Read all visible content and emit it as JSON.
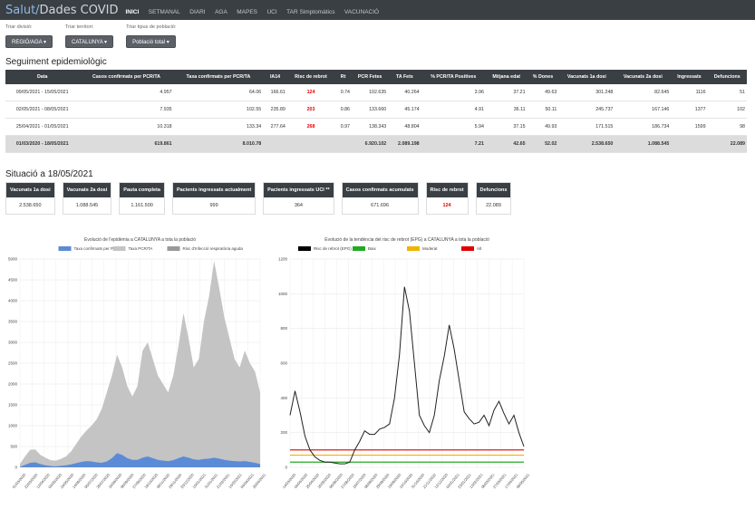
{
  "brand": {
    "part1": "Salut/",
    "part2": "Dades COVID"
  },
  "nav": [
    "INICI",
    "SETMANAL",
    "DIARI",
    "AGA",
    "MAPES",
    "UCI",
    "TAR Simptomàtics",
    "VACUNACIÓ"
  ],
  "filters": [
    {
      "label": "Triar divisió:",
      "value": "REGIÓ/AGA"
    },
    {
      "label": "Triar territori:",
      "value": "CATALUNYA"
    },
    {
      "label": "Triar tipus de població:",
      "value": "Població total"
    }
  ],
  "section1_title": "Seguiment epidemiològic",
  "table": {
    "headers": [
      "Data",
      "Casos confirmats per PCR/TA",
      "Taxa confirmats per PCR/TA",
      "IA14",
      "Risc de rebrot",
      "Rt",
      "PCR Fetes",
      "TA Fets",
      "% PCR/TA Positives",
      "Mitjana edat",
      "% Dones",
      "Vacunats 1a dosi",
      "Vacunats 2a dosi",
      "Ingressats",
      "Defuncions"
    ],
    "rows": [
      [
        "09/05/2021 - 15/05/2021",
        "4.957",
        "64.06",
        "166.61",
        "124",
        "0.74",
        "102.635",
        "40.264",
        "3.96",
        "37.21",
        "49.63",
        "301.248",
        "82.645",
        "1116",
        "51"
      ],
      [
        "02/05/2021 - 08/05/2021",
        "7.935",
        "102.55",
        "235.89",
        "203",
        "0.86",
        "133.660",
        "45.174",
        "4.91",
        "36.11",
        "50.11",
        "245.737",
        "167.146",
        "1377",
        "102"
      ],
      [
        "25/04/2021 - 01/05/2021",
        "10.318",
        "133.34",
        "277.64",
        "268",
        "0.97",
        "138.343",
        "48.804",
        "5.94",
        "37.15",
        "49.93",
        "171.515",
        "186.734",
        "1599",
        "98"
      ]
    ],
    "total": [
      "01/03/2020 - 18/05/2021",
      "619.861",
      "8.010.78",
      "",
      "",
      "",
      "6.920.102",
      "2.089.198",
      "7.21",
      "42.65",
      "52.02",
      "2.538.650",
      "1.088.545",
      "",
      "22.089"
    ]
  },
  "section2_title": "Situació a 18/05/2021",
  "cards": [
    {
      "label": "Vacunats 1a dosi",
      "value": "2.538.650",
      "red": false
    },
    {
      "label": "Vacunats 2a dosi",
      "value": "1.088.545",
      "red": false
    },
    {
      "label": "Pauta completa",
      "value": "1.161.500",
      "red": false
    },
    {
      "label": "Pacients ingressats actualment",
      "value": "999",
      "red": false
    },
    {
      "label": "Pacients ingressats UCI **",
      "value": "364",
      "red": false
    },
    {
      "label": "Casos confirmats acumulats",
      "value": "671.696",
      "red": false
    },
    {
      "label": "Risc de rebrot",
      "value": "124",
      "red": true
    },
    {
      "label": "Defuncions",
      "value": "22.089",
      "red": false
    }
  ],
  "chart_data": [
    {
      "type": "area",
      "title": "Evolució de l'epidèmia a CATALUNYA a tota la població",
      "legend": [
        "Taxa confirmats per PCR/TA",
        "Taxa PCR/TA",
        "Risc d'Infecció respiratòria aguda"
      ],
      "colors": [
        "#5b8bd6",
        "#c4c4c4",
        "#999999"
      ],
      "ylim": [
        0,
        5000
      ],
      "yticks": [
        0,
        500,
        1000,
        1500,
        2000,
        2500,
        3000,
        3500,
        4000,
        4500,
        5000
      ],
      "series": [
        {
          "name": "Taxa PCR/TA",
          "values": [
            80,
            260,
            420,
            430,
            300,
            230,
            170,
            160,
            200,
            260,
            380,
            560,
            740,
            880,
            1000,
            1150,
            1400,
            1800,
            2200,
            2700,
            2400,
            1950,
            1700,
            1950,
            2800,
            3000,
            2600,
            2200,
            2000,
            1800,
            2200,
            2900,
            3700,
            3100,
            2400,
            2600,
            3500,
            4100,
            4950,
            4300,
            3600,
            3100,
            2600,
            2400,
            2800,
            2500,
            2300,
            1800
          ]
        },
        {
          "name": "Taxa confirmats per PCR/TA",
          "values": [
            10,
            60,
            110,
            120,
            80,
            50,
            30,
            25,
            35,
            50,
            70,
            100,
            130,
            150,
            140,
            120,
            110,
            140,
            220,
            340,
            300,
            220,
            180,
            180,
            230,
            260,
            220,
            180,
            160,
            150,
            170,
            220,
            260,
            230,
            190,
            180,
            200,
            210,
            230,
            210,
            180,
            160,
            150,
            140,
            150,
            130,
            110,
            80
          ]
        }
      ],
      "xlabels": [
        "01/03/2020",
        "22/03/2020",
        "12/04/2020",
        "03/05/2020",
        "24/05/2020",
        "14/06/2020",
        "05/07/2020",
        "26/07/2020",
        "16/08/2020",
        "06/09/2020",
        "27/09/2020",
        "18/10/2020",
        "08/11/2020",
        "29/11/2020",
        "20/12/2020",
        "10/01/2021",
        "31/01/2021",
        "21/02/2021",
        "14/03/2021",
        "04/04/2021",
        "25/04/2021"
      ]
    },
    {
      "type": "line",
      "title": "Evolució de la tendència del risc de rebrot (EPG) a CATALUNYA a tota la població",
      "legend": [
        "Risc de rebrot (EPG)",
        "Baix",
        "Moderat",
        "Alt"
      ],
      "colors": [
        "#000000",
        "#22aa22",
        "#f2b200",
        "#e00000"
      ],
      "ylim": [
        0,
        1200
      ],
      "yticks": [
        0,
        200,
        400,
        600,
        800,
        1000,
        1200
      ],
      "series": [
        {
          "name": "Risc de rebrot (EPG)",
          "values": [
            300,
            440,
            320,
            180,
            100,
            60,
            40,
            30,
            30,
            25,
            20,
            20,
            30,
            100,
            150,
            210,
            190,
            190,
            220,
            230,
            250,
            400,
            650,
            1040,
            900,
            600,
            300,
            240,
            200,
            300,
            500,
            640,
            820,
            680,
            500,
            320,
            280,
            250,
            260,
            300,
            240,
            330,
            380,
            310,
            250,
            300,
            200,
            120
          ]
        },
        {
          "name": "Baix",
          "values": [
            30,
            30
          ]
        },
        {
          "name": "Moderat",
          "values": [
            70,
            70
          ]
        },
        {
          "name": "Alt",
          "values": [
            100,
            100
          ]
        }
      ],
      "xlabels": [
        "14/03/2020",
        "04/04/2020",
        "25/04/2020",
        "16/05/2020",
        "06/06/2020",
        "27/06/2020",
        "18/07/2020",
        "08/08/2020",
        "29/08/2020",
        "19/09/2020",
        "10/10/2020",
        "31/10/2020",
        "21/11/2020",
        "12/12/2020",
        "02/01/2021",
        "23/01/2021",
        "13/02/2021",
        "06/03/2021",
        "27/03/2021",
        "17/04/2021",
        "08/05/2021"
      ]
    }
  ]
}
